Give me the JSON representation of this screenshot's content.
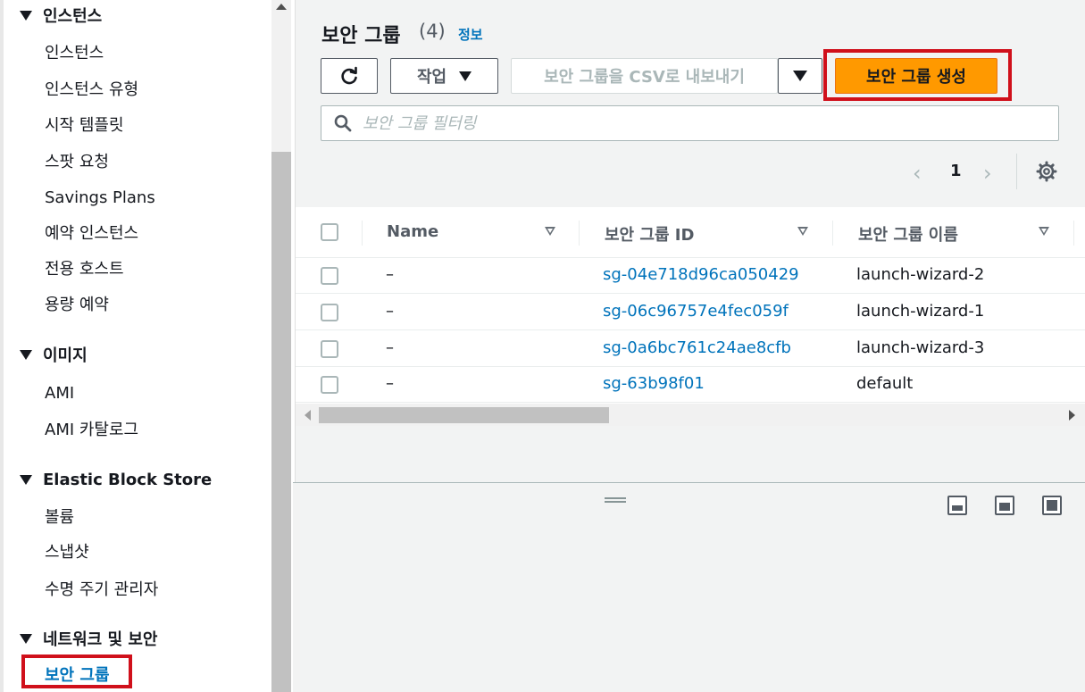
{
  "sidebar": {
    "sections": [
      {
        "label": "인스턴스",
        "items": [
          "인스턴스",
          "인스턴스 유형",
          "시작 템플릿",
          "스팟 요청",
          "Savings Plans",
          "예약 인스턴스",
          "전용 호스트",
          "용량 예약"
        ]
      },
      {
        "label": "이미지",
        "items": [
          "AMI",
          "AMI 카탈로그"
        ]
      },
      {
        "label": "Elastic Block Store",
        "items": [
          "볼륨",
          "스냅샷",
          "수명 주기 관리자"
        ]
      },
      {
        "label": "네트워크 및 보안",
        "items": [
          "보안 그룹"
        ]
      }
    ],
    "active_item": "보안 그룹"
  },
  "header": {
    "title": "보안 그룹",
    "count": "(4)",
    "info_link": "정보"
  },
  "toolbar": {
    "refresh_icon": "refresh-icon",
    "actions_label": "작업",
    "export_label": "보안 그룹을 CSV로 내보내기",
    "create_label": "보안 그룹 생성"
  },
  "search": {
    "placeholder": "보안 그룹 필터링",
    "icon": "search-icon"
  },
  "pagination": {
    "prev": "‹",
    "page": "1",
    "next": "›",
    "settings_icon": "gear-icon"
  },
  "table": {
    "columns": [
      "Name",
      "보안 그룹 ID",
      "보안 그룹 이름"
    ],
    "rows": [
      {
        "name": "–",
        "id": "sg-04e718d96ca050429",
        "group_name": "launch-wizard-2"
      },
      {
        "name": "–",
        "id": "sg-06c96757e4fec059f",
        "group_name": "launch-wizard-1"
      },
      {
        "name": "–",
        "id": "sg-0a6bc761c24ae8cfb",
        "group_name": "launch-wizard-3"
      },
      {
        "name": "–",
        "id": "sg-63b98f01",
        "group_name": "default"
      }
    ]
  },
  "colors": {
    "primary_button": "#ff9900",
    "link": "#0073bb",
    "highlight": "#d0101b"
  }
}
